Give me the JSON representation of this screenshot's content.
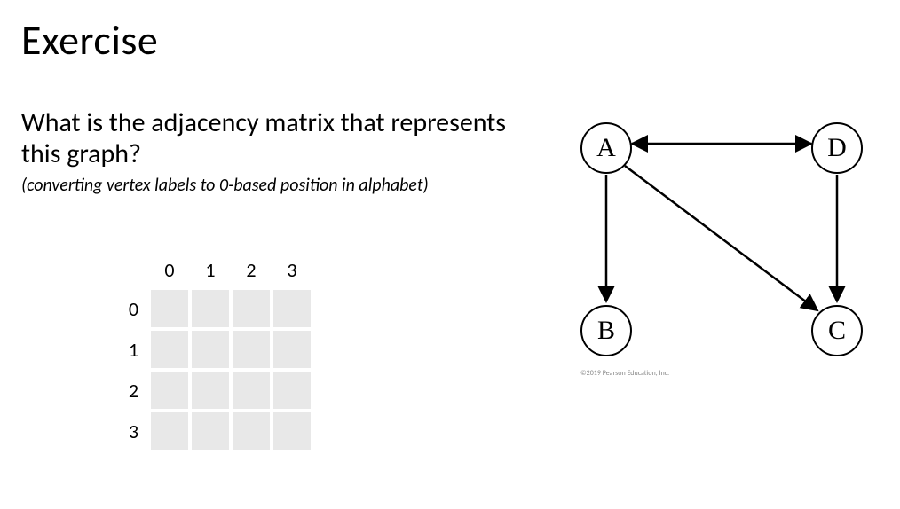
{
  "title": "Exercise",
  "question": "What is the adjacency matrix that represents this graph?",
  "hint": "(converting vertex labels to 0-based position in alphabet)",
  "matrix": {
    "col_headers": [
      "0",
      "1",
      "2",
      "3"
    ],
    "row_headers": [
      "0",
      "1",
      "2",
      "3"
    ],
    "cells": [
      [
        "",
        "",
        "",
        ""
      ],
      [
        "",
        "",
        "",
        ""
      ],
      [
        "",
        "",
        "",
        ""
      ],
      [
        "",
        "",
        "",
        ""
      ]
    ]
  },
  "graph": {
    "nodes": {
      "A": "A",
      "B": "B",
      "C": "C",
      "D": "D"
    },
    "copyright": "©2019 Pearson Education, Inc."
  },
  "chart_data": {
    "type": "directed_graph",
    "vertices": [
      "A",
      "B",
      "C",
      "D"
    ],
    "edges": [
      {
        "from": "A",
        "to": "B"
      },
      {
        "from": "A",
        "to": "C"
      },
      {
        "from": "A",
        "to": "D"
      },
      {
        "from": "D",
        "to": "A"
      },
      {
        "from": "D",
        "to": "C"
      }
    ],
    "vertex_index": {
      "A": 0,
      "B": 1,
      "C": 2,
      "D": 3
    }
  }
}
